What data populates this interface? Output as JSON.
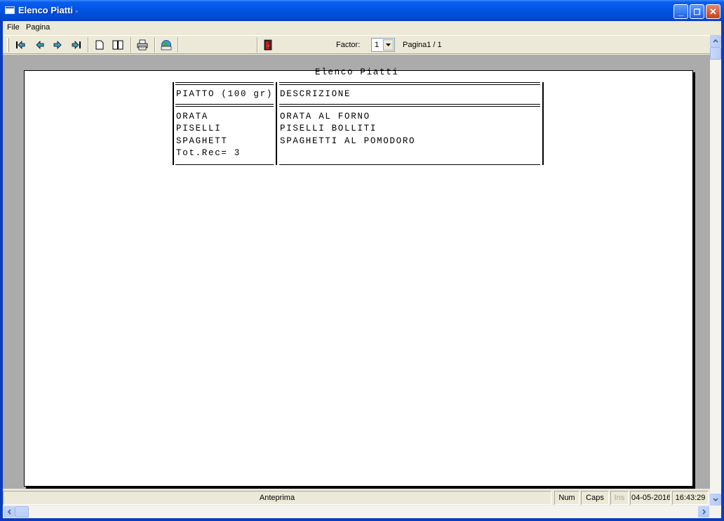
{
  "window": {
    "title": "Elenco Piatti"
  },
  "menu": {
    "file": "File",
    "pagina": "Pagina"
  },
  "toolbar": {
    "factor_label": "Factor:",
    "factor_value": "1",
    "page_indicator": "Pagina1 / 1",
    "icons": [
      "first-page-icon",
      "previous-page-icon",
      "next-page-icon",
      "last-page-icon",
      "single-page-icon",
      "two-pages-icon",
      "printer-icon",
      "globe-icon",
      "exit-door-icon"
    ]
  },
  "report": {
    "title": "Elenco Piatti",
    "columns": [
      "PIATTO (100 gr)",
      "DESCRIZIONE"
    ],
    "rows": [
      [
        "ORATA",
        "ORATA AL FORNO"
      ],
      [
        "PISELLI",
        "PISELLI BOLLITI"
      ],
      [
        "SPAGHETT",
        "SPAGHETTI AL POMODORO"
      ]
    ],
    "total": "Tot.Rec= 3"
  },
  "status": {
    "main": "Anteprima",
    "num": "Num",
    "caps": "Caps",
    "ins": "Ins",
    "date": "04-05-2016",
    "time": "16:43:29"
  },
  "colors": {
    "titlebar": "#0a5ef0",
    "preview_bg": "#ababab",
    "face": "#ece9d8"
  }
}
